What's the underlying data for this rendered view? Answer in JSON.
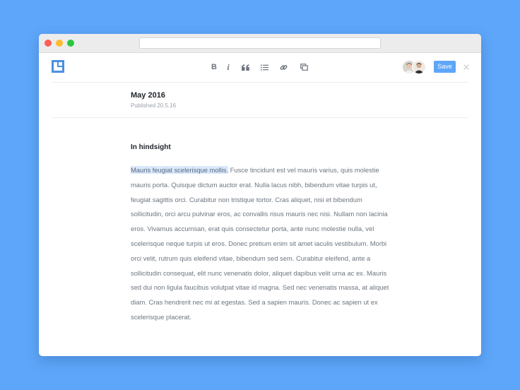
{
  "editor": {
    "toolbar": {
      "bold_label": "B",
      "italic_label": "i",
      "save_label": "Save"
    },
    "document": {
      "title": "May 2016",
      "published": "Published 20.5.16",
      "heading": "In hindsight",
      "highlighted_text": "Mauris feugiat scelerisque mollis.",
      "body_text": " Fusce tincidunt est vel mauris varius, quis molestie mauris porta. Quisque dictum auctor erat. Nulla lacus nibh, bibendum vitae turpis ut, feugiat sagittis orci. Curabitur non tristique tortor. Cras aliquet, nisi et bibendum sollicitudin, orci arcu pulvinar eros, ac convallis risus mauris nec nisi. Nullam non lacinia eros. Vivamus accumsan, erat quis consectetur porta, ante nunc molestie nulla, vel scelerisque neque turpis ut eros. Donec pretium enim sit amet iaculis vestibulum. Morbi orci velit, rutrum quis eleifend vitae, bibendum sed sem. Curabitur eleifend, ante a sollicitudin consequat, elit nunc venenatis dolor, aliquet dapibus velit urna ac ex. Mauris sed dui non ligula faucibus volutpat vitae id magna. Sed nec venenatis massa, at aliquet diam. Cras hendrerit nec mi at egestas. Sed a sapien mauris. Donec ac sapien ut ex scelerisque placerat."
    }
  },
  "icons": {
    "logo": "app-logo-icon",
    "quote": "quote-icon",
    "list": "list-icon",
    "link": "link-icon",
    "copy": "copy-icon",
    "close": "close-icon"
  },
  "colors": {
    "background": "#5ea6f9",
    "accent": "#5ea6f9",
    "highlight": "#d9e8fb",
    "text": "#6d7680",
    "heading": "#1e2329"
  }
}
